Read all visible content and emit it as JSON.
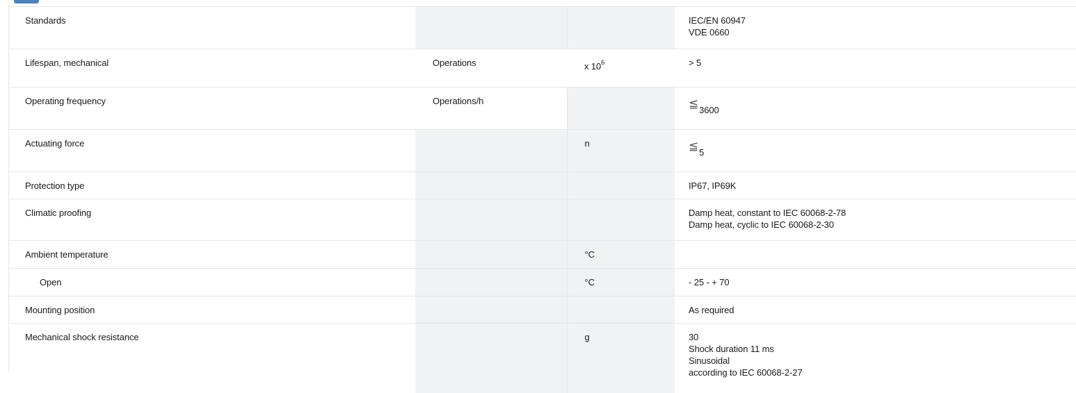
{
  "rows": [
    {
      "label": "Standards",
      "unit": "",
      "factor": "",
      "value_lines": [
        "IEC/EN 60947",
        "VDE 0660"
      ]
    },
    {
      "label": "Lifespan, mechanical",
      "unit": "Operations",
      "factor_base": "x 10",
      "factor_exp": "6",
      "value_lines": [
        "> 5"
      ]
    },
    {
      "label": "Operating frequency",
      "unit": "Operations/h",
      "factor": "",
      "value_prefix": "≦",
      "value_sub": "3600"
    },
    {
      "label": "Actuating force",
      "unit": "",
      "factor": "n",
      "value_prefix": "≦",
      "value_sub": "5"
    },
    {
      "label": "Protection type",
      "unit": "",
      "factor": "",
      "value_lines": [
        "IP67, IP69K"
      ]
    },
    {
      "label": "Climatic proofing",
      "unit": "",
      "factor": "",
      "value_lines": [
        "Damp heat, constant to IEC 60068-2-78",
        "Damp heat, cyclic to IEC 60068-2-30"
      ]
    },
    {
      "label": "Ambient temperature",
      "unit": "",
      "factor": "°C",
      "value_lines": [
        ""
      ]
    },
    {
      "label": "Open",
      "unit": "",
      "factor": "°C",
      "value_lines": [
        "- 25 - + 70"
      ]
    },
    {
      "label": "Mounting position",
      "unit": "",
      "factor": "",
      "value_lines": [
        "As required"
      ]
    },
    {
      "label": "Mechanical shock resistance",
      "unit": "",
      "factor": "g",
      "value_lines": [
        "30",
        "Shock duration 11 ms",
        "Sinusoidal",
        "according to IEC 60068-2-27"
      ]
    }
  ]
}
